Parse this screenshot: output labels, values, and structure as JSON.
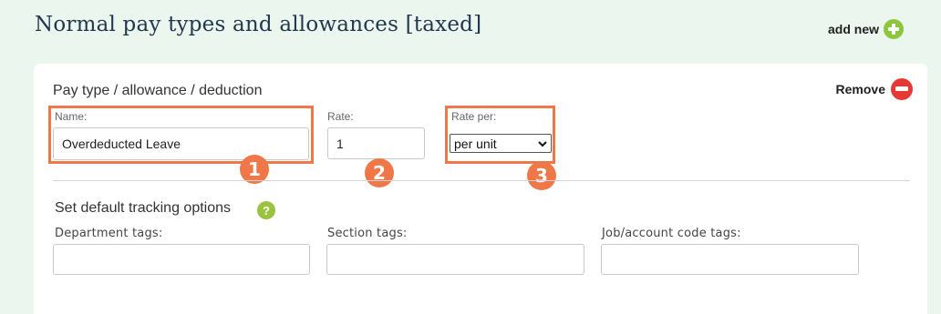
{
  "header": {
    "title": "Normal pay types and allowances [taxed]",
    "add_new_label": "add new",
    "add_new_icon": "plus-circle-icon"
  },
  "pay_type": {
    "heading": "Pay type / allowance / deduction",
    "remove_label": "Remove",
    "remove_icon": "minus-circle-icon",
    "name_label": "Name:",
    "name_value": "Overdeducted Leave",
    "rate_label": "Rate:",
    "rate_value": "1",
    "rate_per_label": "Rate per:",
    "rate_per_value": "per unit"
  },
  "tracking": {
    "heading": "Set default tracking options",
    "help_icon": "?",
    "department_label": "Department tags:",
    "department_value": "",
    "section_label": "Section tags:",
    "section_value": "",
    "job_label": "Job/account code tags:",
    "job_value": ""
  },
  "annotations": {
    "badge_1": "1",
    "badge_2": "2",
    "badge_3": "3",
    "highlight_color": "#f07848"
  },
  "colors": {
    "background": "#eaf6ee",
    "title": "#23384e",
    "add_icon": "#8cc63f",
    "remove_icon": "#e53935",
    "help_icon": "#9ac43f"
  }
}
